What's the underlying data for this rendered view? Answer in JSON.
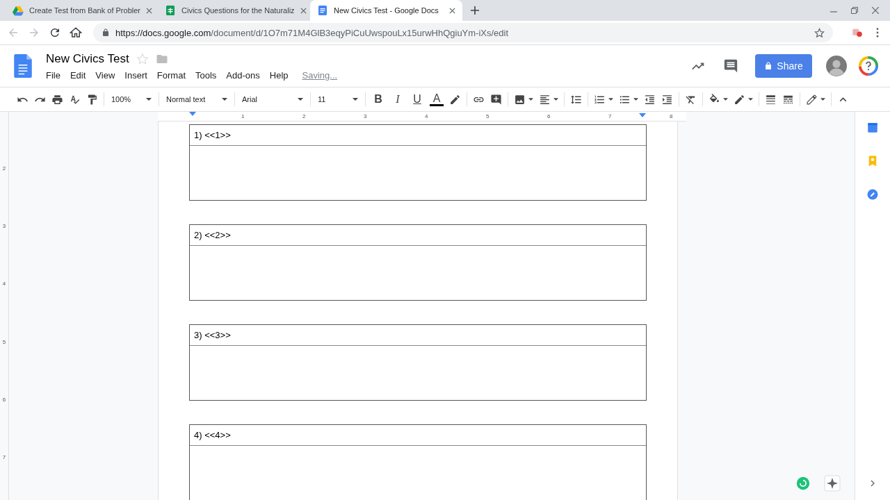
{
  "browser": {
    "tabs": [
      {
        "title": "Create Test from Bank of Probler",
        "kind": "drive",
        "selected": false
      },
      {
        "title": "Civics Questions for the Naturaliz",
        "kind": "sheets",
        "selected": false
      },
      {
        "title": "New Civics Test - Google Docs",
        "kind": "docs",
        "selected": true
      }
    ],
    "url": {
      "host": "https://docs.google.com",
      "path": "/document/d/1O7m71M4GlB3eqyPiCuUwspouLx15urwHhQgiuYm-iXs/edit"
    }
  },
  "document": {
    "title": "New Civics Test",
    "menu": [
      "File",
      "Edit",
      "View",
      "Insert",
      "Format",
      "Tools",
      "Add-ons",
      "Help"
    ],
    "status": "Saving..."
  },
  "share_button": "Share",
  "toolbar": {
    "zoom": "100%",
    "style": "Normal text",
    "font": "Arial",
    "size": "11",
    "format_buttons": [
      {
        "label": "B",
        "kind": "bold"
      },
      {
        "label": "I",
        "kind": "italic"
      },
      {
        "label": "U",
        "kind": "underline"
      },
      {
        "label": "A",
        "kind": "color"
      }
    ]
  },
  "ruler": {
    "marks": [
      "1",
      "2",
      "3",
      "4",
      "5",
      "6",
      "7",
      "8"
    ],
    "vertical_marks": [
      "2",
      "3",
      "4",
      "5",
      "6",
      "7"
    ]
  },
  "questions": [
    "1) <<1>>",
    "2) <<2>>",
    "3) <<3>>",
    "4) <<4>>"
  ]
}
